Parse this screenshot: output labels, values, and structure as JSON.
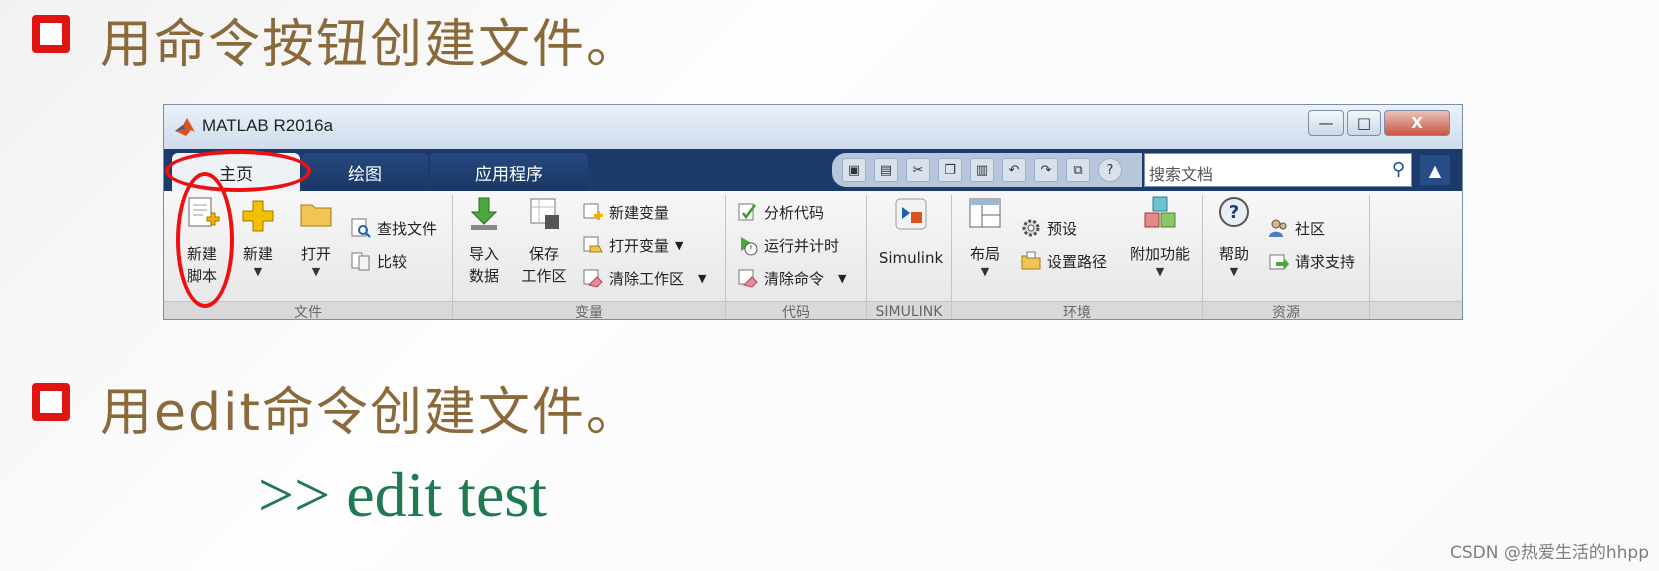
{
  "slide": {
    "bullet1": "用命令按钮创建文件。",
    "bullet2": "用edit命令创建文件。",
    "command": ">> edit test",
    "footer": "CSDN @热爱生活的hhpp"
  },
  "window": {
    "title": "MATLAB R2016a",
    "controls": {
      "minimize": "—",
      "maximize": "□",
      "close": "X"
    }
  },
  "tabs": [
    {
      "label": "主页",
      "active": true
    },
    {
      "label": "绘图",
      "active": false
    },
    {
      "label": "应用程序",
      "active": false
    }
  ],
  "search": {
    "placeholder": "搜索文档"
  },
  "quick_access_icons": [
    "layout-icon",
    "save-icon",
    "cut-icon",
    "copy-icon",
    "paste-icon",
    "undo-icon",
    "redo-icon",
    "switch-windows-icon",
    "help-icon"
  ],
  "ribbon": {
    "file": {
      "label": "文件",
      "new_script": [
        "新建",
        "脚本"
      ],
      "new": "新建",
      "open": "打开",
      "find_files": "查找文件",
      "compare": "比较"
    },
    "variable": {
      "label": "变量",
      "import": [
        "导入",
        "数据"
      ],
      "save_ws": [
        "保存",
        "工作区"
      ],
      "new_var": "新建变量",
      "open_var": "打开变量",
      "clear_ws": "清除工作区"
    },
    "code": {
      "label": "代码",
      "analyze": "分析代码",
      "run_time": "运行并计时",
      "clear_cmd": "清除命令"
    },
    "simulink": {
      "label": "SIMULINK",
      "simulink": "Simulink"
    },
    "environment": {
      "label": "环境",
      "layout": "布局",
      "preferences": "预设",
      "set_path": "设置路径",
      "addons": "附加功能"
    },
    "resources": {
      "label": "资源",
      "help": "帮助",
      "community": "社区",
      "request_support": "请求支持"
    }
  },
  "colors": {
    "annotation": "#ee1010",
    "slide_text": "#8a6a3a",
    "command_text": "#1f7a52",
    "tabbar": "#1c3b6b"
  }
}
